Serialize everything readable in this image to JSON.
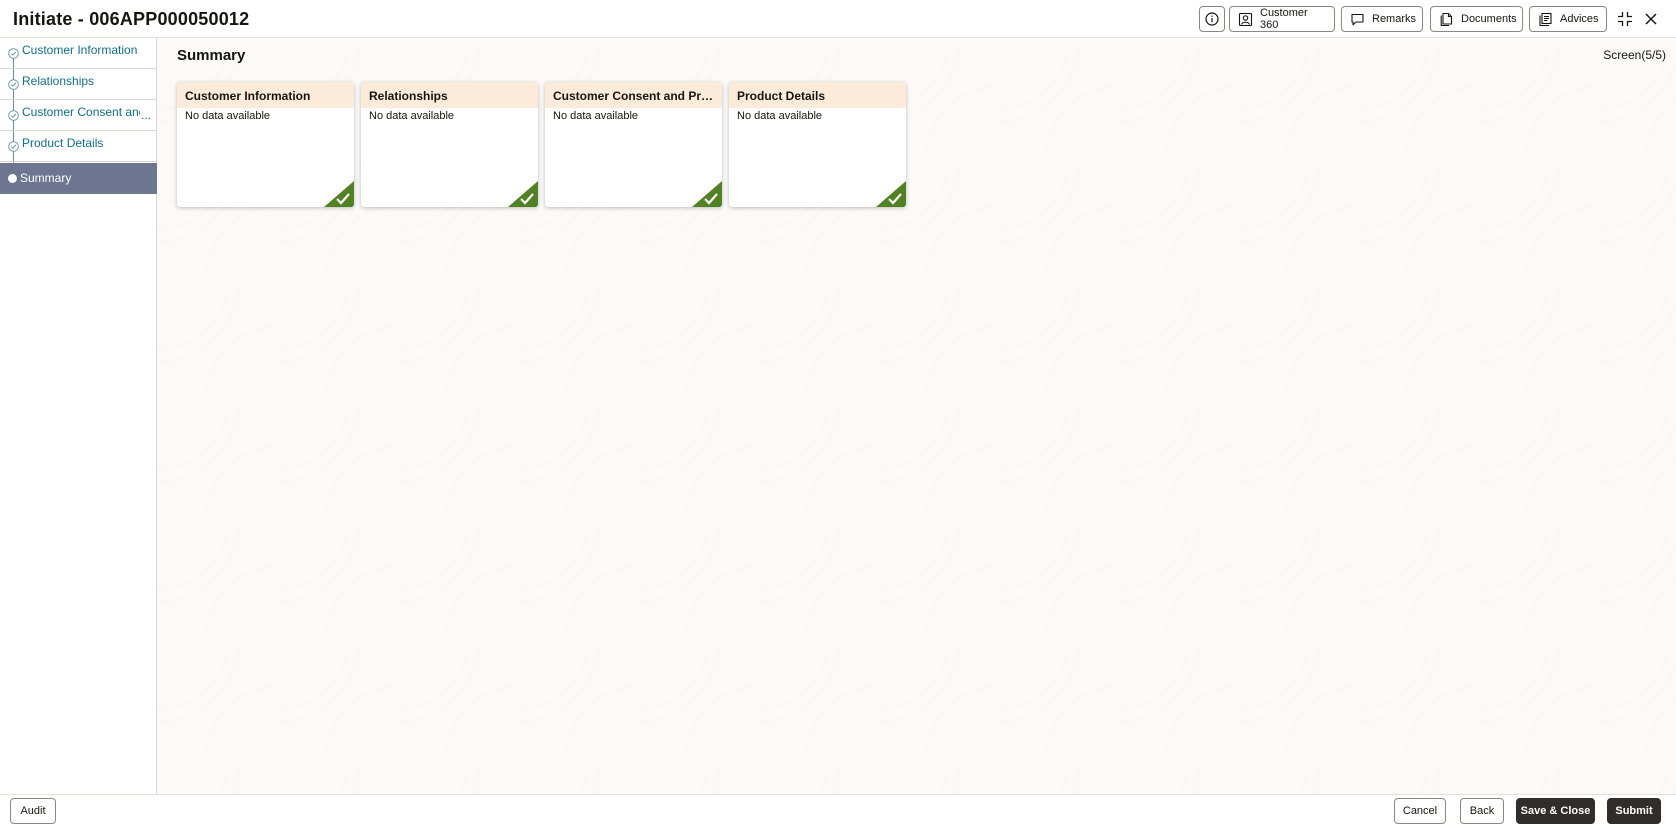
{
  "header": {
    "title": "Initiate - 006APP000050012",
    "buttons": {
      "customer360": "Customer 360",
      "remarks": "Remarks",
      "documents": "Documents",
      "advices": "Advices"
    }
  },
  "sidebar": {
    "items": [
      {
        "label": "Customer Information",
        "status": "completed"
      },
      {
        "label": "Relationships",
        "status": "completed"
      },
      {
        "label": "Customer Consent and",
        "status": "completed"
      },
      {
        "label": "Product Details",
        "status": "completed"
      },
      {
        "label": "Summary",
        "status": "active"
      }
    ],
    "ellipsis": "..."
  },
  "main": {
    "heading": "Summary",
    "screen_indicator": "Screen(5/5)",
    "cards": [
      {
        "title": "Customer Information",
        "body": "No data available"
      },
      {
        "title": "Relationships",
        "body": "No data available"
      },
      {
        "title": "Customer Consent and Pref...",
        "body": "No data available"
      },
      {
        "title": "Product Details",
        "body": "No data available"
      }
    ]
  },
  "footer": {
    "audit": "Audit",
    "cancel": "Cancel",
    "back": "Back",
    "save_close": "Save & Close",
    "submit": "Submit"
  },
  "colors": {
    "accent_teal": "#0f6e8a",
    "active_step": "#6d7591",
    "card_header": "#fcebd9",
    "success_green": "#508223",
    "dark_button": "#302d2b"
  }
}
